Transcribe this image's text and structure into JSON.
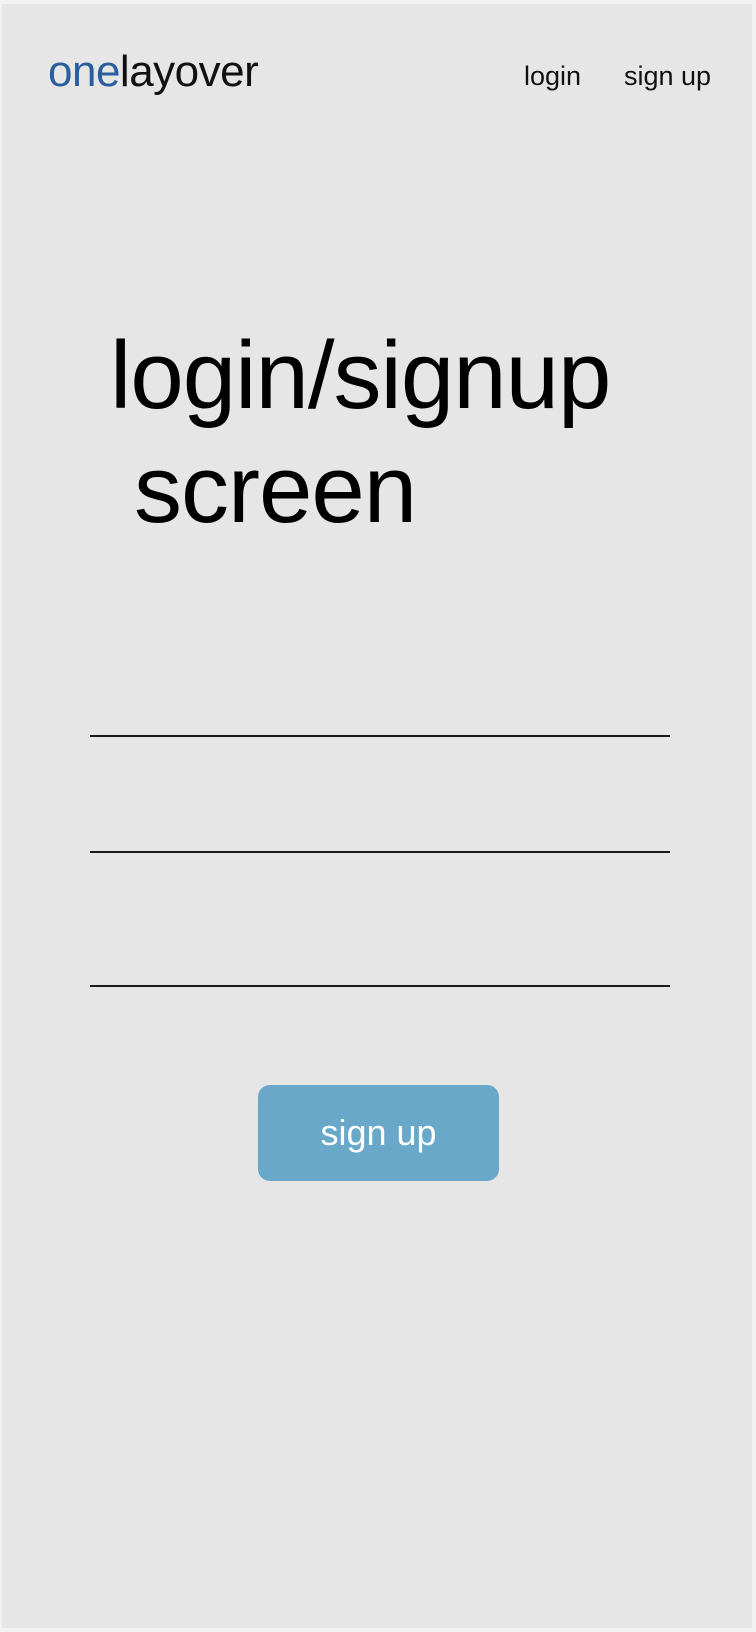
{
  "header": {
    "logo_highlight": "one",
    "logo_rest": "layover",
    "nav": {
      "login_label": "login",
      "signup_label": "sign up"
    }
  },
  "main": {
    "title_line1": "login/signup",
    "title_line2": "screen",
    "fields": [
      {
        "value": "",
        "placeholder": ""
      },
      {
        "value": "",
        "placeholder": ""
      },
      {
        "value": "",
        "placeholder": ""
      }
    ],
    "submit_label": "sign up"
  },
  "colors": {
    "background": "#e6e6e6",
    "logo_accent": "#2a5e9f",
    "button": "#6aa8c9",
    "button_text": "#ffffff"
  }
}
